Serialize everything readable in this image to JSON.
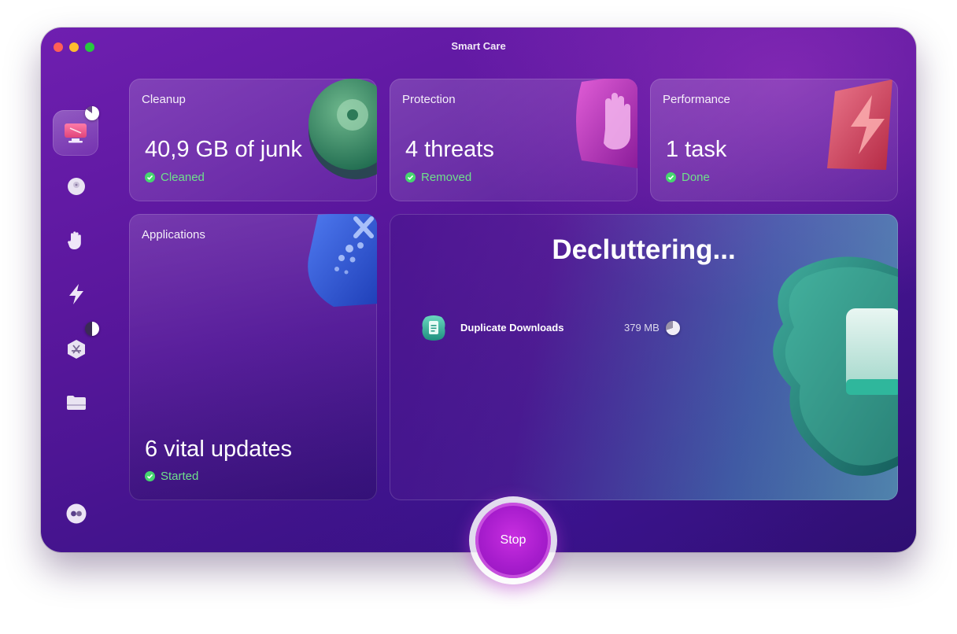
{
  "window": {
    "title": "Smart Care"
  },
  "cards": {
    "cleanup": {
      "title": "Cleanup",
      "value": "40,9 GB of junk",
      "status": "Cleaned"
    },
    "protection": {
      "title": "Protection",
      "value": "4 threats",
      "status": "Removed"
    },
    "performance": {
      "title": "Performance",
      "value": "1 task",
      "status": "Done"
    },
    "applications": {
      "title": "Applications",
      "value": "6 vital updates",
      "status": "Started"
    }
  },
  "main": {
    "heading": "Decluttering...",
    "task": {
      "name": "Duplicate Downloads",
      "size": "379 MB",
      "progress": 0.7
    }
  },
  "sidebar": {
    "cleanup_progress": 0.85,
    "applications_progress": 0.5
  },
  "stop_button": {
    "label": "Stop"
  },
  "colors": {
    "accent": "#a61ccc",
    "status_green": "#6fe08b",
    "background": "#5a179d"
  }
}
